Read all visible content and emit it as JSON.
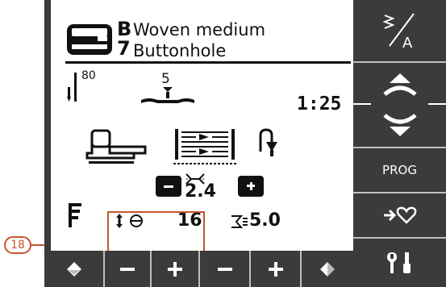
{
  "callout": {
    "number": "18",
    "color": "#c8552e"
  },
  "header": {
    "fabric_code": "B",
    "fabric_name": "Woven medium",
    "stitch_code": "7",
    "stitch_name": "Buttonhole"
  },
  "needle": {
    "size": "80"
  },
  "presser_foot": {
    "pressure": "5"
  },
  "stitch_number": "1:25",
  "width_value": "2.4",
  "bottom_row": {
    "buttonhole_length": "16",
    "stitch_length": "5.0"
  },
  "right_column": {
    "prog_label": "PROG"
  },
  "colors": {
    "panel": "#3b3b3b",
    "lcd_bg": "#ffffff",
    "ink": "#111111"
  }
}
